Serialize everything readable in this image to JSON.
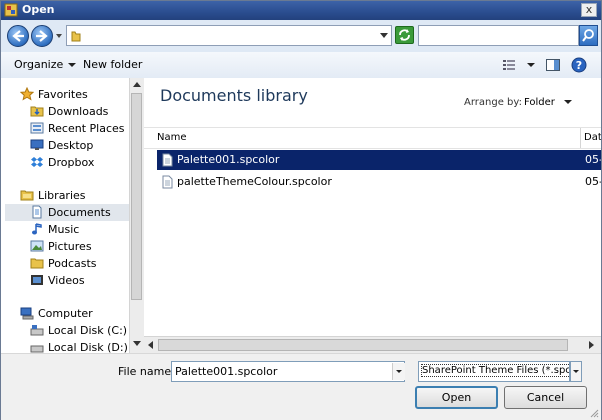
{
  "window": {
    "title": "Open",
    "close_symbol": "x"
  },
  "address": {
    "path": "",
    "search_placeholder": ""
  },
  "toolbar": {
    "organize": "Organize",
    "new_folder": "New folder"
  },
  "nav": {
    "favorites": "Favorites",
    "favorite_items": [
      "Downloads",
      "Recent Places",
      "Desktop",
      "Dropbox"
    ],
    "libraries": "Libraries",
    "library_items": [
      "Documents",
      "Music",
      "Pictures",
      "Podcasts",
      "Videos"
    ],
    "computer": "Computer",
    "computer_items": [
      "Local Disk (C:)",
      "Local Disk (D:)"
    ],
    "selected": "Documents"
  },
  "content": {
    "title": "Documents library",
    "arrange_label": "Arrange by:",
    "arrange_value": "Folder",
    "columns": {
      "name": "Name",
      "date": "Dat"
    },
    "files": [
      {
        "name": "Palette001.spcolor",
        "date": "05-",
        "selected": true
      },
      {
        "name": "paletteThemeColour.spcolor",
        "date": "05-",
        "selected": false
      }
    ]
  },
  "bottom": {
    "file_name_label": "File name:",
    "file_name_value": "Palette001.spcolor",
    "file_type_value": "SharePoint Theme Files (*.spcolor)",
    "open_label": "Open",
    "cancel_label": "Cancel"
  },
  "colors": {
    "title_bar": "#2a4d8f",
    "selection": "#0a246a",
    "accent": "#1e395b"
  }
}
